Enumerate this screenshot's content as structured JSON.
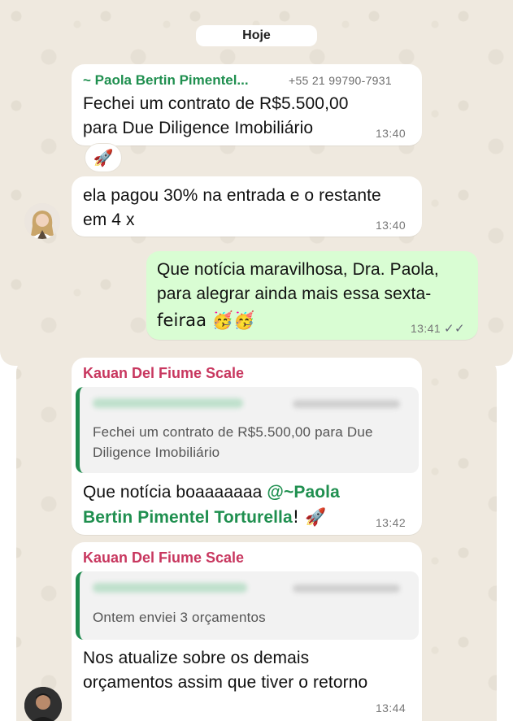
{
  "date_label": "Hoje",
  "messages": {
    "m1": {
      "sender": "~ Paola Bertin Pimentel...",
      "phone": "+55 21 99790-7931",
      "line1": "Fechei um contrato de R$5.500,00",
      "line2": "para Due Diligence Imobiliário",
      "time": "13:40",
      "reaction": "🚀"
    },
    "m2": {
      "line1": "ela pagou 30% na entrada e o restante",
      "line2": "em 4 x",
      "time": "13:40"
    },
    "m3": {
      "line1": "Que notícia maravilhosa, Dra. Paola,",
      "line2": "para alegrar ainda mais essa sexta-",
      "line3": "feiraa 🥳🥳",
      "time": "13:41",
      "status_icon": "double-check-icon"
    },
    "m4": {
      "sender": "Kauan Del Fiume Scale",
      "quote_line1": "Fechei um contrato de R$5.500,00 para Due",
      "quote_line2": "Diligence Imobiliário",
      "line1_prefix": "Que notícia boaaaaaaa ",
      "mention1": "@~Paola",
      "mention2": "Bertin Pimentel Torturella",
      "line2_suffix": "! 🚀",
      "time": "13:42"
    },
    "m5": {
      "sender": "Kauan Del Fiume Scale",
      "quote_line1": "Ontem enviei 3 orçamentos",
      "line1": "Nos atualize sobre os demais",
      "line2": "orçamentos assim que tiver o retorno",
      "time": "13:44"
    }
  },
  "colors": {
    "wallpaper": "#efe9df",
    "outgoing": "#d9fdd3",
    "sender_green": "#1f8f4f",
    "sender_pink": "#c8375f"
  }
}
